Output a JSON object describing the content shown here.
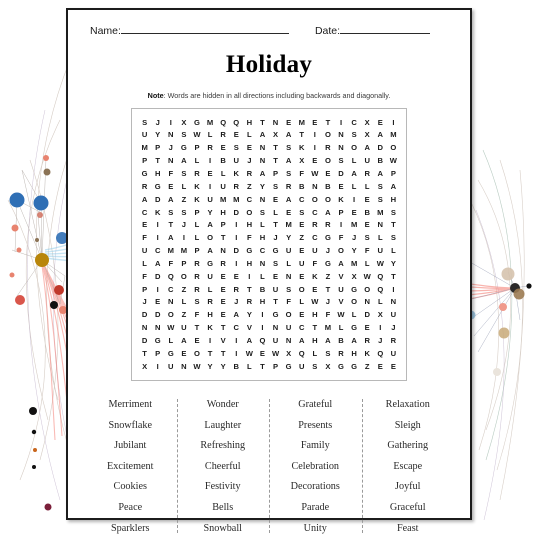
{
  "worksheet": {
    "name_label": "Name:",
    "date_label": "Date:",
    "title": "Holiday",
    "note_prefix": "Note",
    "note_text": ": Words are hidden in all directions including backwards and diagonally."
  },
  "grid": {
    "rows": 20,
    "cols": 20,
    "letters": [
      "S J I X G M Q Q H T N E M E T I C X E I",
      "U Y N S W L R E L A X A T I O N S X A M",
      "M P J G P R E S E N T S K I R N O A D O",
      "P T N A L I B U J N T A X E O S L U B W",
      "G H F S R E L K R A P S F W E D A R A P",
      "R G E L K I U R Z Y S R B N B E L L S A",
      "A D A Z K U M M C N E A C O O K I E S H",
      "C K S S P Y H D O S L E S C A P E B M S",
      "E I T J L A P I H L T M E R R I M E N T",
      "F I A I L O T I F H J Y Z C G F J S L S",
      "U C M M P A N D G C G U E U J O Y F U L",
      "L A F P R G R I H N S L U F G A M L W Y",
      "F D Q O R U E E I L E N E K Z V X W Q T",
      "P I C Z R L E R T B U S O E T U G O Q I",
      "J E N L S R E J R H T F L W J V O N L N",
      "D D O Z F H E A Y I G O E H F W L D X U",
      "N N W U T K T C V I N U C T M L G E I J",
      "D G L A E I V I A Q U N A H A B A R J R",
      "T P G E O T T I W E W X Q L S R H K Q U",
      "X I U N W Y Y B L T P G U S X G G Z E E"
    ]
  },
  "word_list": {
    "columns": [
      [
        "Merriment",
        "Snowflake",
        "Jubilant",
        "Excitement",
        "Cookies",
        "Peace",
        "Sparklers"
      ],
      [
        "Wonder",
        "Laughter",
        "Refreshing",
        "Cheerful",
        "Festivity",
        "Bells",
        "Snowball"
      ],
      [
        "Grateful",
        "Presents",
        "Family",
        "Celebration",
        "Decorations",
        "Parade",
        "Unity"
      ],
      [
        "Relaxation",
        "Sleigh",
        "Gathering",
        "Escape",
        "Joyful",
        "Graceful",
        "Feast"
      ]
    ]
  },
  "decoration": {
    "type": "network-graph",
    "colors": {
      "node_blue": "#2f6fb5",
      "node_red": "#d94a3d",
      "node_salmon": "#e8836f",
      "node_gold": "#b8860b",
      "node_black": "#111111",
      "edge_light": "#cfc4bb",
      "bundle_red": "#f5837a",
      "bundle_blue": "#8fcbe8"
    }
  }
}
